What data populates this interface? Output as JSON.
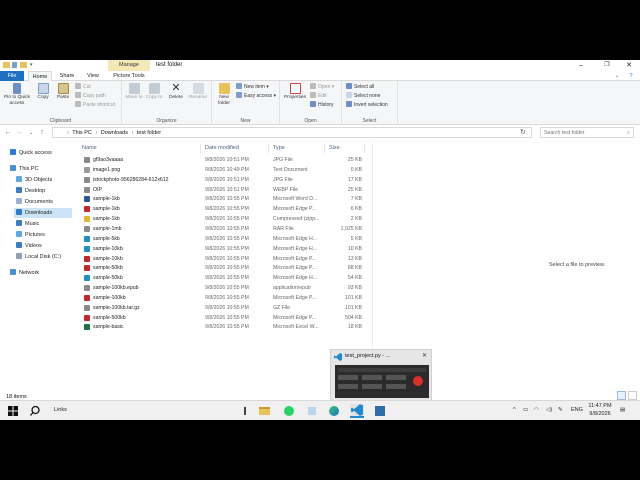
{
  "window": {
    "title": "test folder",
    "manage_label": "Manage",
    "minimize": "–",
    "maximize": "❐",
    "close": "✕"
  },
  "ribbon_tabs": {
    "file": "File",
    "home": "Home",
    "share": "Share",
    "view": "View",
    "picture_tools": "Picture Tools"
  },
  "ribbon": {
    "clipboard": {
      "label": "Clipboard",
      "pin": "Pin to Quick access",
      "copy": "Copy",
      "paste": "Paste",
      "cut": "Cut",
      "copy_path": "Copy path",
      "paste_shortcut": "Paste shortcut"
    },
    "organize": {
      "label": "Organize",
      "move_to": "Move to",
      "copy_to": "Copy to",
      "delete": "Delete",
      "rename": "Rename"
    },
    "new": {
      "label": "New",
      "new_folder": "New folder",
      "new_item": "New item ▾",
      "easy_access": "Easy access ▾"
    },
    "open": {
      "label": "Open",
      "properties": "Properties",
      "open": "Open ▾",
      "edit": "Edit",
      "history": "History"
    },
    "select": {
      "label": "Select",
      "select_all": "Select all",
      "select_none": "Select none",
      "invert": "Invert selection"
    }
  },
  "address": {
    "crumbs": [
      "This PC",
      "Downloads",
      "test folder"
    ],
    "search_placeholder": "Search test folder"
  },
  "nav": {
    "quick_access": "Quick access",
    "this_pc": "This PC",
    "objects3d": "3D Objects",
    "desktop": "Desktop",
    "documents": "Documents",
    "downloads": "Downloads",
    "music": "Music",
    "pictures": "Pictures",
    "videos": "Videos",
    "local_disk": "Local Disk (C:)",
    "network": "Network"
  },
  "columns": {
    "name": "Name",
    "date": "Date modified",
    "type": "Type",
    "size": "Size"
  },
  "files": [
    {
      "name": "gf9ao3vaaaa",
      "date": "9/8/2026 10:51 PM",
      "type": "JPG File",
      "size": "25 KB",
      "color": "#8a8a8a"
    },
    {
      "name": "image1.png",
      "date": "9/8/2026 10:49 PM",
      "type": "Text Document",
      "size": "0 KB",
      "color": "#9a9a9a"
    },
    {
      "name": "istockphoto-956286284-612x612",
      "date": "9/8/2026 10:51 PM",
      "type": "JPG File",
      "size": "17 KB",
      "color": "#8a8a8a"
    },
    {
      "name": "OIP",
      "date": "9/8/2026 10:51 PM",
      "type": "WEBP File",
      "size": "25 KB",
      "color": "#8a8a8a"
    },
    {
      "name": "sample-1kb",
      "date": "9/8/2026 10:55 PM",
      "type": "Microsoft Word D...",
      "size": "7 KB",
      "color": "#2b5797"
    },
    {
      "name": "sample-1kb",
      "date": "9/8/2026 10:55 PM",
      "type": "Microsoft Edge P...",
      "size": "6 KB",
      "color": "#c4262e"
    },
    {
      "name": "sample-1kb",
      "date": "9/8/2026 10:55 PM",
      "type": "Compressed (zipp...",
      "size": "2 KB",
      "color": "#e5b530"
    },
    {
      "name": "sample-1mb",
      "date": "9/8/2026 10:55 PM",
      "type": "RAR File",
      "size": "1,025 KB",
      "color": "#8a8a8a"
    },
    {
      "name": "sample-5kb",
      "date": "9/8/2026 10:55 PM",
      "type": "Microsoft Edge H...",
      "size": "5 KB",
      "color": "#1f8fbf"
    },
    {
      "name": "sample-10kb",
      "date": "9/8/2026 10:55 PM",
      "type": "Microsoft Edge H...",
      "size": "10 KB",
      "color": "#1f8fbf"
    },
    {
      "name": "sample-10kb",
      "date": "9/8/2026 10:55 PM",
      "type": "Microsoft Edge P...",
      "size": "13 KB",
      "color": "#c4262e"
    },
    {
      "name": "sample-50kb",
      "date": "9/8/2026 10:55 PM",
      "type": "Microsoft Edge P...",
      "size": "88 KB",
      "color": "#c4262e"
    },
    {
      "name": "sample-50kb",
      "date": "9/8/2026 10:55 PM",
      "type": "Microsoft Edge H...",
      "size": "54 KB",
      "color": "#1f8fbf"
    },
    {
      "name": "sample-100kb.epub",
      "date": "9/8/2026 10:55 PM",
      "type": "application/epub",
      "size": "93 KB",
      "color": "#8a8a8a"
    },
    {
      "name": "sample-100kb",
      "date": "9/8/2026 10:55 PM",
      "type": "Microsoft Edge P...",
      "size": "101 KB",
      "color": "#c4262e"
    },
    {
      "name": "sample-100kb.tar.gz",
      "date": "9/8/2026 10:55 PM",
      "type": "GZ File",
      "size": "101 KB",
      "color": "#8a8a8a"
    },
    {
      "name": "sample-500kb",
      "date": "9/8/2026 10:55 PM",
      "type": "Microsoft Edge P...",
      "size": "504 KB",
      "color": "#c4262e"
    },
    {
      "name": "sample-basic",
      "date": "9/8/2026 10:55 PM",
      "type": "Microsoft Excel W...",
      "size": "18 KB",
      "color": "#1e7145"
    }
  ],
  "preview": {
    "message": "Select a file to preview."
  },
  "status": {
    "count": "18 items"
  },
  "thumbnail": {
    "title": "test_project.py - ...",
    "close": "✕"
  },
  "taskbar": {
    "search_text": "Links",
    "lang": "ENG",
    "time": "11:47 PM",
    "date": "9/8/2026"
  }
}
